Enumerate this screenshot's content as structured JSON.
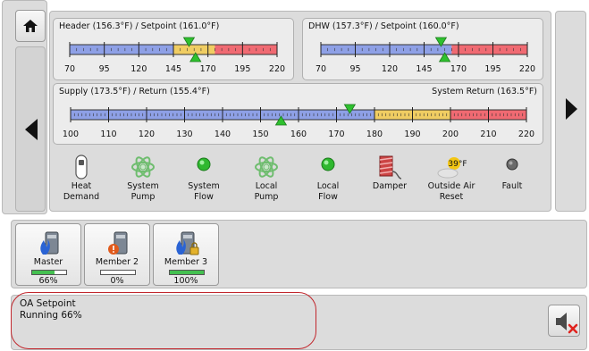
{
  "header_gauge": {
    "title": "Header (156.3°F) / Setpoint (161.0°F)",
    "min": 70,
    "max": 220,
    "ticks": [
      "70",
      "95",
      "120",
      "145",
      "170",
      "195",
      "220"
    ],
    "bands": [
      [
        70,
        145,
        "#8ea0e6"
      ],
      [
        145,
        175,
        "#f0cd62"
      ],
      [
        175,
        220,
        "#f06a72"
      ]
    ],
    "value": 156.3,
    "setpoint": 161.0
  },
  "dhw_gauge": {
    "title": "DHW (157.3°F) / Setpoint (160.0°F)",
    "min": 70,
    "max": 220,
    "ticks": [
      "70",
      "95",
      "120",
      "145",
      "170",
      "195",
      "220"
    ],
    "bands": [
      [
        70,
        165,
        "#8ea0e6"
      ],
      [
        165,
        220,
        "#f06a72"
      ]
    ],
    "value": 157.3,
    "setpoint": 160.0
  },
  "supply_gauge": {
    "title": "Supply (173.5°F) / Return (155.4°F)",
    "right_title": "System Return (163.5°F)",
    "min": 100,
    "max": 220,
    "ticks": [
      "100",
      "110",
      "120",
      "130",
      "140",
      "150",
      "160",
      "170",
      "180",
      "190",
      "200",
      "210",
      "220"
    ],
    "bands": [
      [
        100,
        180,
        "#8ea0e6"
      ],
      [
        180,
        200,
        "#f0cd62"
      ],
      [
        200,
        220,
        "#f06a72"
      ]
    ],
    "supply": 173.5,
    "return": 155.4
  },
  "indicators": [
    {
      "label": "Heat\nDemand",
      "icon": "heat-demand-switch-icon"
    },
    {
      "label": "System\nPump",
      "icon": "pump-icon"
    },
    {
      "label": "System\nFlow",
      "icon": "flow-led-icon"
    },
    {
      "label": "Local\nPump",
      "icon": "pump-icon"
    },
    {
      "label": "Local\nFlow",
      "icon": "flow-led-icon"
    },
    {
      "label": "Damper",
      "icon": "damper-icon"
    },
    {
      "label": "Outside Air\nReset",
      "icon": "outside-air-icon",
      "temp": "39°F"
    },
    {
      "label": "Fault",
      "icon": "fault-led-icon"
    }
  ],
  "boilers": [
    {
      "name": "Master",
      "percent": "66%",
      "fill": 0.66,
      "icon": "boiler-flame-icon"
    },
    {
      "name": "Member 2",
      "percent": "0%",
      "fill": 0.0,
      "icon": "boiler-warning-icon"
    },
    {
      "name": "Member 3",
      "percent": "100%",
      "fill": 1.0,
      "icon": "boiler-locked-flame-icon"
    }
  ],
  "status": {
    "line1": "OA Setpoint",
    "line2": "Running 66%"
  },
  "colors": {
    "blue_band": "#8ea0e6",
    "yellow_band": "#f0cd62",
    "red_band": "#f06a72",
    "marker_green": "#2ec02e",
    "status_outline": "#c1272d"
  }
}
